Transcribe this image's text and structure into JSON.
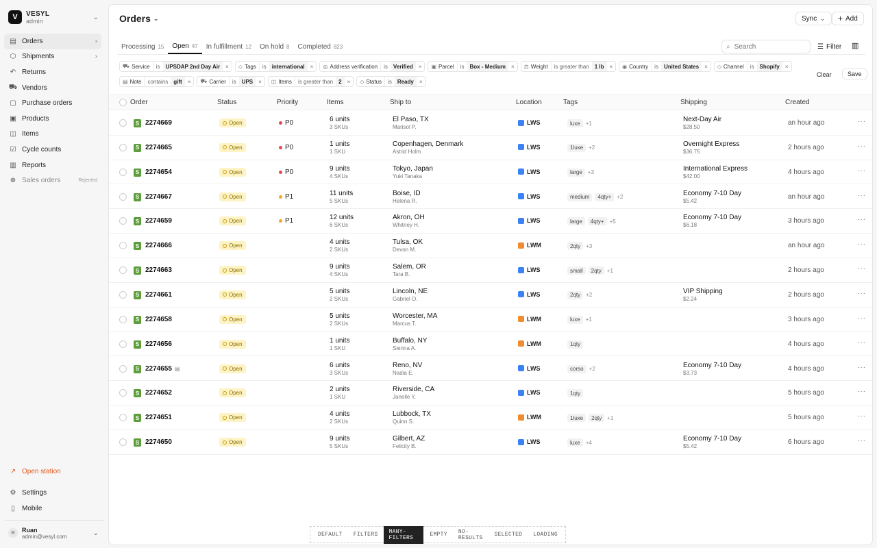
{
  "workspace": {
    "initial": "V",
    "name": "VESYL",
    "role": "admin"
  },
  "nav": [
    {
      "icon": "▤",
      "label": "Orders",
      "right": "›",
      "name": "sidebar-item-orders",
      "icon_name": "clipboard-icon"
    },
    {
      "icon": "⬡",
      "label": "Shipments",
      "right": "›",
      "name": "sidebar-item-shipments",
      "icon_name": "box-icon"
    },
    {
      "icon": "↶",
      "label": "Returns",
      "right": "",
      "name": "sidebar-item-returns",
      "icon_name": "return-icon"
    },
    {
      "icon": "⛟",
      "label": "Vendors",
      "right": "",
      "name": "sidebar-item-vendors",
      "icon_name": "truck-icon"
    },
    {
      "icon": "▢",
      "label": "Purchase orders",
      "right": "",
      "name": "sidebar-item-purchase-orders",
      "icon_name": "document-icon"
    },
    {
      "icon": "▣",
      "label": "Products",
      "right": "",
      "name": "sidebar-item-products",
      "icon_name": "package-icon"
    },
    {
      "icon": "◫",
      "label": "Items",
      "right": "",
      "name": "sidebar-item-items",
      "icon_name": "items-icon"
    },
    {
      "icon": "☑",
      "label": "Cycle counts",
      "right": "",
      "name": "sidebar-item-cycle-counts",
      "icon_name": "checklist-icon"
    },
    {
      "icon": "▥",
      "label": "Reports",
      "right": "",
      "name": "sidebar-item-reports",
      "icon_name": "bar-chart-icon"
    },
    {
      "icon": "⊕",
      "label": "Sales orders",
      "right": "Rejected",
      "name": "sidebar-item-sales-orders",
      "icon_name": "cart-icon"
    }
  ],
  "bottom_nav": {
    "open_station": "Open station",
    "settings": "Settings",
    "mobile": "Mobile"
  },
  "user": {
    "initial": "R",
    "name": "Ruan",
    "email": "admin@vesyl.com"
  },
  "header": {
    "title": "Orders",
    "sync_label": "Sync",
    "add_label": "Add"
  },
  "tabs": [
    {
      "label": "Processing",
      "count": "15"
    },
    {
      "label": "Open",
      "count": "47"
    },
    {
      "label": "In fulfillment",
      "count": "12"
    },
    {
      "label": "On hold",
      "count": "8"
    },
    {
      "label": "Completed",
      "count": "823"
    }
  ],
  "search": {
    "placeholder": "Search"
  },
  "filter_label": "Filter",
  "filters_row1": [
    {
      "field": "Service",
      "op": "is",
      "value": "UPSDAP 2nd Day Air"
    },
    {
      "field": "Tags",
      "op": "is",
      "value": "international"
    },
    {
      "field": "Address verification",
      "op": "is",
      "value": "Verified"
    },
    {
      "field": "Parcel",
      "op": "is",
      "value": "Box - Medium"
    },
    {
      "field": "Weight",
      "op": "is greater than",
      "value": "1 lb"
    },
    {
      "field": "Country",
      "op": "is",
      "value": "United States"
    },
    {
      "field": "Channel",
      "op": "is",
      "value": "Shopify"
    }
  ],
  "filters_row2": [
    {
      "field": "Note",
      "op": "contains",
      "value": "gift"
    },
    {
      "field": "Carrier",
      "op": "is",
      "value": "UPS"
    },
    {
      "field": "Items",
      "op": "is greater than",
      "value": "2"
    },
    {
      "field": "Status",
      "op": "is",
      "value": "Ready"
    }
  ],
  "filter_actions": {
    "clear": "Clear",
    "save": "Save"
  },
  "columns": {
    "order": "Order",
    "status": "Status",
    "priority": "Priority",
    "items": "Items",
    "ship_to": "Ship to",
    "location": "Location",
    "tags": "Tags",
    "shipping": "Shipping",
    "created": "Created"
  },
  "rows": [
    {
      "order": "2274669",
      "status": "Open",
      "priority": "P0",
      "units": "6 units",
      "skus": "3 SKUs",
      "city": "El Paso, TX",
      "person": "Marisol P.",
      "location": "LWS",
      "tags": [
        "luxe"
      ],
      "more": "+1",
      "ship": "Next-Day Air",
      "price": "$28.50",
      "created": "an hour ago"
    },
    {
      "order": "2274665",
      "status": "Open",
      "priority": "P0",
      "units": "1 units",
      "skus": "1 SKU",
      "city": "Copenhagen, Denmark",
      "person": "Astrid Holm",
      "location": "LWS",
      "tags": [
        "1luxe"
      ],
      "more": "+2",
      "ship": "Overnight Express",
      "price": "$36.75",
      "created": "2 hours ago"
    },
    {
      "order": "2274654",
      "status": "Open",
      "priority": "P0",
      "units": "9 units",
      "skus": "4 SKUs",
      "city": "Tokyo, Japan",
      "person": "Yuki Tanaka",
      "location": "LWS",
      "tags": [
        "large"
      ],
      "more": "+3",
      "ship": "International Express",
      "price": "$42.00",
      "created": "4 hours ago"
    },
    {
      "order": "2274667",
      "status": "Open",
      "priority": "P1",
      "units": "11 units",
      "skus": "5 SKUs",
      "city": "Boise, ID",
      "person": "Helena R.",
      "location": "LWS",
      "tags": [
        "medium",
        "4qty+"
      ],
      "more": "+2",
      "ship": "Economy 7-10 Day",
      "price": "$5.42",
      "created": "an hour ago"
    },
    {
      "order": "2274659",
      "status": "Open",
      "priority": "P1",
      "units": "12 units",
      "skus": "6 SKUs",
      "city": "Akron, OH",
      "person": "Whitney H.",
      "location": "LWS",
      "tags": [
        "large",
        "4qty+"
      ],
      "more": "+5",
      "ship": "Economy 7-10 Day",
      "price": "$6.18",
      "created": "3 hours ago"
    },
    {
      "order": "2274666",
      "status": "Open",
      "priority": "",
      "units": "4 units",
      "skus": "2 SKUs",
      "city": "Tulsa, OK",
      "person": "Devon M.",
      "location": "LWM",
      "tags": [
        "2qty"
      ],
      "more": "+3",
      "ship": "",
      "price": "",
      "created": "an hour ago"
    },
    {
      "order": "2274663",
      "status": "Open",
      "priority": "",
      "units": "9 units",
      "skus": "4 SKUs",
      "city": "Salem, OR",
      "person": "Tara B.",
      "location": "LWS",
      "tags": [
        "small",
        "2qty"
      ],
      "more": "+1",
      "ship": "",
      "price": "",
      "created": "2 hours ago"
    },
    {
      "order": "2274661",
      "status": "Open",
      "priority": "",
      "units": "5 units",
      "skus": "2 SKUs",
      "city": "Lincoln, NE",
      "person": "Gabriel O.",
      "location": "LWS",
      "tags": [
        "2qty"
      ],
      "more": "+2",
      "ship": "VIP Shipping",
      "price": "$2.24",
      "created": "2 hours ago"
    },
    {
      "order": "2274658",
      "status": "Open",
      "priority": "",
      "units": "5 units",
      "skus": "2 SKUs",
      "city": "Worcester, MA",
      "person": "Marcus T.",
      "location": "LWM",
      "tags": [
        "luxe"
      ],
      "more": "+1",
      "ship": "",
      "price": "",
      "created": "3 hours ago"
    },
    {
      "order": "2274656",
      "status": "Open",
      "priority": "",
      "units": "1 units",
      "skus": "1 SKU",
      "city": "Buffalo, NY",
      "person": "Sienna A.",
      "location": "LWM",
      "tags": [
        "1qty"
      ],
      "more": "",
      "ship": "",
      "price": "",
      "created": "4 hours ago"
    },
    {
      "order": "2274655",
      "status": "Open",
      "priority": "",
      "units": "6 units",
      "skus": "3 SKUs",
      "city": "Reno, NV",
      "person": "Nadia E.",
      "location": "LWS",
      "tags": [
        "corso"
      ],
      "more": "+2",
      "ship": "Economy 7-10 Day",
      "price": "$3.73",
      "created": "4 hours ago",
      "note": true
    },
    {
      "order": "2274652",
      "status": "Open",
      "priority": "",
      "units": "2 units",
      "skus": "1 SKU",
      "city": "Riverside, CA",
      "person": "Janelle Y.",
      "location": "LWS",
      "tags": [
        "1qty"
      ],
      "more": "",
      "ship": "",
      "price": "",
      "created": "5 hours ago"
    },
    {
      "order": "2274651",
      "status": "Open",
      "priority": "",
      "units": "4 units",
      "skus": "2 SKUs",
      "city": "Lubbock, TX",
      "person": "Quinn S.",
      "location": "LWM",
      "tags": [
        "1luxe",
        "2qty"
      ],
      "more": "+1",
      "ship": "",
      "price": "",
      "created": "5 hours ago"
    },
    {
      "order": "2274650",
      "status": "Open",
      "priority": "",
      "units": "9 units",
      "skus": "5 SKUs",
      "city": "Gilbert, AZ",
      "person": "Felicity B.",
      "location": "LWS",
      "tags": [
        "luxe"
      ],
      "more": "+4",
      "ship": "Economy 7-10 Day",
      "price": "$5.42",
      "created": "6 hours ago"
    }
  ],
  "switcher": [
    "DEFAULT",
    "FILTERS",
    "MANY-FILTERS",
    "EMPTY",
    "NO-RESULTS",
    "SELECTED",
    "LOADING"
  ],
  "switcher_active": "MANY-FILTERS",
  "colors": {
    "p0": "#e5484d",
    "p1": "#f5a524",
    "lws": "#3b82f6",
    "lwm": "#f08c2e",
    "accent": "#e1571b"
  }
}
